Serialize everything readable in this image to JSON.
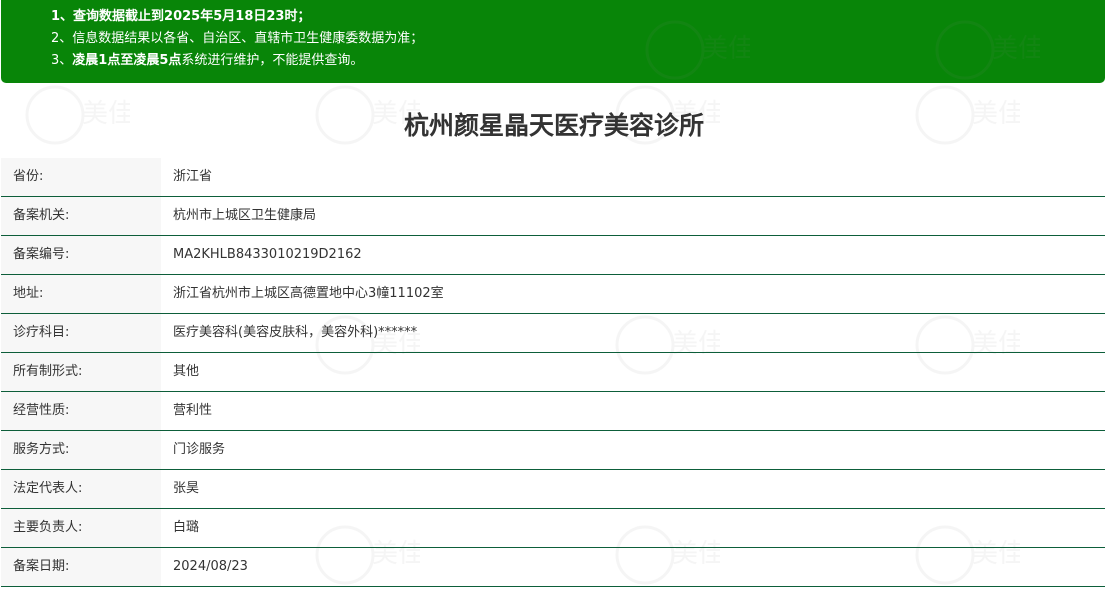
{
  "notice": {
    "line1": "1、查询数据截止到2025年5月18日23时；",
    "line2": "2、信息数据结果以各省、自治区、直辖市卫生健康委数据为准；",
    "line3_prefix": "3、",
    "line3_bold": "凌晨1点至凌晨5点",
    "line3_suffix": "系统进行维护，不能提供查询。"
  },
  "title": "杭州颜星晶天医疗美容诊所",
  "rows": [
    {
      "label": "省份:",
      "value": "浙江省"
    },
    {
      "label": "备案机关:",
      "value": "杭州市上城区卫生健康局"
    },
    {
      "label": "备案编号:",
      "value": "MA2KHLB8433010219D2162"
    },
    {
      "label": "地址:",
      "value": "浙江省杭州市上城区高德置地中心3幢11102室"
    },
    {
      "label": "诊疗科目:",
      "value": "医疗美容科(美容皮肤科，美容外科)******"
    },
    {
      "label": "所有制形式:",
      "value": "其他"
    },
    {
      "label": "经营性质:",
      "value": "营利性"
    },
    {
      "label": "服务方式:",
      "value": "门诊服务"
    },
    {
      "label": "法定代表人:",
      "value": "张昊"
    },
    {
      "label": "主要负责人:",
      "value": "白璐"
    },
    {
      "label": "备案日期:",
      "value": "2024/08/23"
    }
  ],
  "watermark": {
    "icon": "site-logo-watermark",
    "text": "2362.com"
  },
  "colors": {
    "banner": "#088508",
    "row_border": "#0d5e3a",
    "label_bg": "#f7f7f7"
  }
}
